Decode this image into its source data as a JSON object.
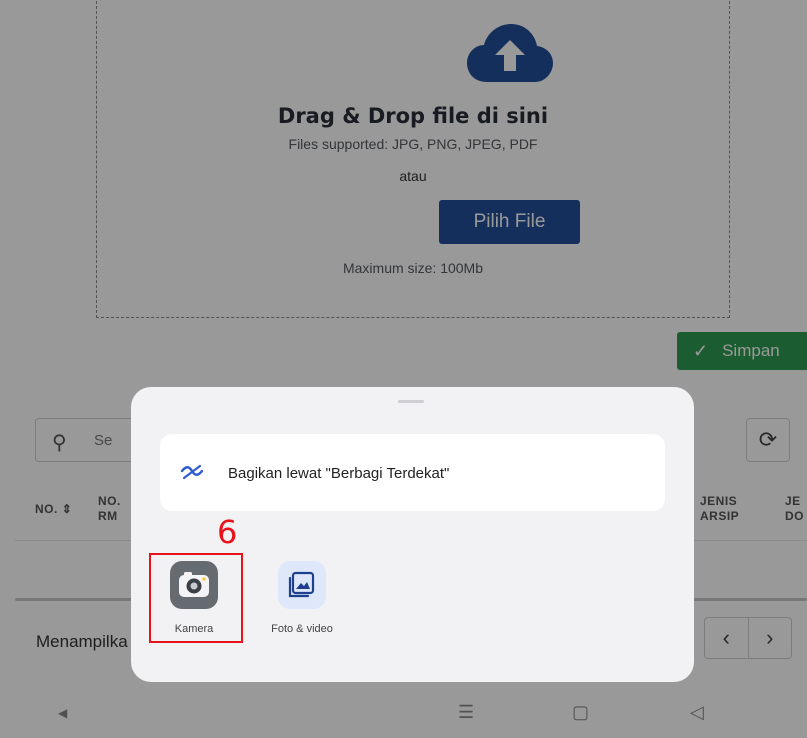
{
  "upload": {
    "title": "Drag & Drop file di sini",
    "supported": "Files supported: JPG, PNG, JPEG, PDF",
    "or": "atau",
    "button": "Pilih File",
    "max_size": "Maximum size: 100Mb"
  },
  "save_button": "Simpan",
  "search": {
    "placeholder_visible": "Se"
  },
  "table": {
    "headers": {
      "no": "NO.",
      "no_rm_line1": "NO.",
      "no_rm_line2": "RM",
      "jenis_line1": "JENIS",
      "jenis_line2": "ARSIP",
      "jen_line1": "JE",
      "jen_line2": "DO"
    }
  },
  "footer": {
    "showing": "Menampilka"
  },
  "share_sheet": {
    "nearby_label": "Bagikan lewat \"Berbagi Terdekat\"",
    "apps": [
      {
        "label": "Kamera",
        "icon": "camera-icon"
      },
      {
        "label": "Foto & video",
        "icon": "gallery-icon"
      }
    ]
  },
  "annotation": {
    "step": "6",
    "color": "#e8121b"
  },
  "colors": {
    "primary": "#234f9c",
    "success": "#2e9c50",
    "overlay": "rgba(0,0,0,0.40)"
  }
}
